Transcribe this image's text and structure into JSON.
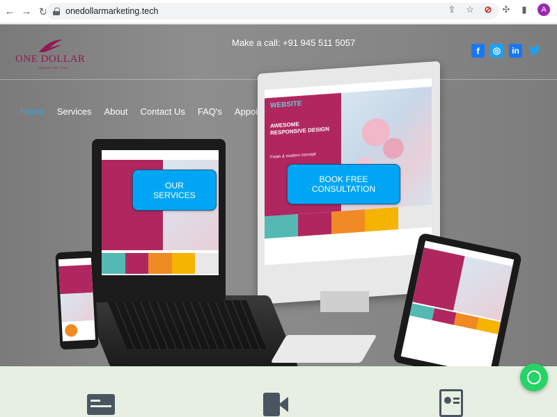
{
  "browser": {
    "url": "onedollarmarketing.tech",
    "avatar_letter": "A"
  },
  "header": {
    "brand": "ONE DOLLAR",
    "brand_sub": "MARKETING TECH",
    "call_text": "Make a call: +91 945 511 5057",
    "social": {
      "facebook": "f",
      "instagram": "◎",
      "linkedin": "in",
      "twitter": "🐦"
    }
  },
  "nav": {
    "items": [
      {
        "label": "Home",
        "active": true
      },
      {
        "label": "Services"
      },
      {
        "label": "About"
      },
      {
        "label": "Contact Us"
      },
      {
        "label": "FAQ's"
      },
      {
        "label": "Appointment Booking"
      }
    ]
  },
  "hero": {
    "services_btn": "OUR SERVICES",
    "book_btn": "BOOK FREE CONSULTATION",
    "mockup": {
      "title": "WEBSITE",
      "headline": "AWESOME RESPONSIVE DESIGN",
      "tagline": "Fresh & modern concept"
    }
  },
  "colors": {
    "accent": "#26a9e0",
    "cta": "#00a6f5",
    "brand": "#8e1a52",
    "features_bg": "#e6efe1",
    "whatsapp": "#25d366"
  }
}
